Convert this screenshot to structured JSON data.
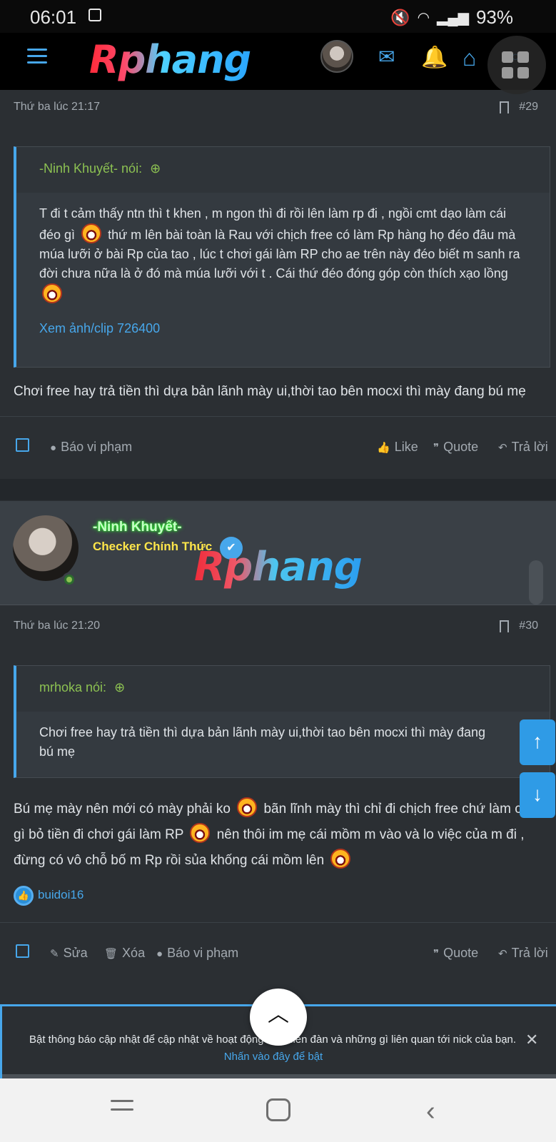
{
  "status_bar": {
    "time": "06:01",
    "battery": "93%"
  },
  "navbar": {
    "logo": "Rphang"
  },
  "posts": [
    {
      "meta_time": "Thứ ba lúc 21:17",
      "number": "#29",
      "quote": {
        "author_line": "-Ninh Khuyết- nói:",
        "body_1": "T đi t cảm thấy ntn thì t khen , m ngon thì đi rồi lên làm rp đi , ngồi cmt dạo làm cái đéo gì",
        "body_2": "thứ m lên bài toàn là Rau với chịch free có làm Rp hàng họ đéo đâu mà múa lưỡi ở bài Rp của tao , lúc t chơi gái làm RP cho ae trên này đéo biết m sanh ra đời chưa nữa là ở đó mà múa lưỡi với t . Cái thứ đéo đóng góp còn thích xạo lồng",
        "link": "Xem ảnh/clip 726400"
      },
      "text": "Chơi free hay trả tiền thì dựa bản lãnh mày ui,thời tao bên mocxi thì mày đang bú mẹ",
      "actions": {
        "report": "Báo vi phạm",
        "like": "Like",
        "quote": "Quote",
        "reply": "Trả lời"
      }
    },
    {
      "author": "-Ninh Khuyết-",
      "user_title": "Checker Chính Thức",
      "watermark": "Rphang",
      "meta_time": "Thứ ba lúc 21:20",
      "number": "#30",
      "quote": {
        "author_line": "mrhoka nói:",
        "body": "Chơi free hay trả tiền thì dựa bản lãnh mày ui,thời tao bên mocxi thì mày đang bú mẹ"
      },
      "text_1": "Bú mẹ mày nên mới có mày phải ko",
      "text_2": "bãn lĩnh mày thì chỉ đi chịch free chứ làm cặc gì bỏ tiền đi chơi gái làm RP",
      "text_3": "nên thôi im mẹ cái mồm m vào và lo việc của m đi , đừng có vô chỗ bố m Rp rồi sủa khống cái mồm lên",
      "reaction_user": "buidoi16",
      "actions": {
        "edit": "Sửa",
        "delete": "Xóa",
        "report": "Báo vi phạm",
        "quote": "Quote",
        "reply": "Trả lời"
      }
    }
  ],
  "notification": {
    "text": "Bật thông báo cập nhật để cập nhật về hoạt động của diễn đàn và những gì liên quan tới nick của bạn.",
    "link": "Nhấn vào đây để bật"
  },
  "colors": {
    "accent": "#47a7eb",
    "quote_author": "#8cc152",
    "background": "#2b2f33"
  }
}
